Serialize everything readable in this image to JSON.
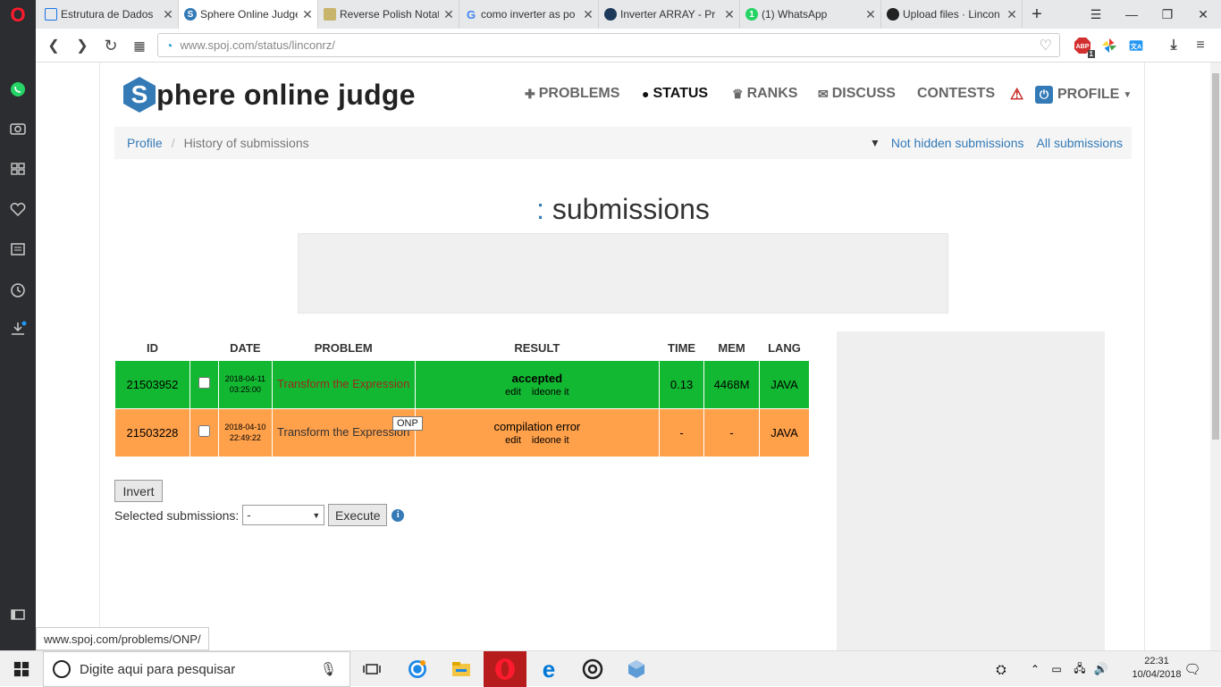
{
  "browser": {
    "tabs": [
      {
        "label": "Estrutura de Dados",
        "favicon": "doc-icon",
        "active": false
      },
      {
        "label": "Sphere Online Judge",
        "favicon": "spoj-icon",
        "active": true
      },
      {
        "label": "Reverse Polish Notation",
        "favicon": "book-icon",
        "active": false
      },
      {
        "label": "como inverter as po",
        "favicon": "google-icon",
        "active": false
      },
      {
        "label": "Inverter ARRAY - Pr",
        "favicon": "stackoverflow-icon",
        "active": false
      },
      {
        "label": "(1) WhatsApp",
        "favicon": "whatsapp-icon",
        "active": false
      },
      {
        "label": "Upload files · Lincon",
        "favicon": "github-icon",
        "active": false
      }
    ],
    "url_host": "www.spoj.com",
    "url_path": "/status/linconrz/",
    "status_url": "www.spoj.com/problems/ONP/",
    "ext_abp_badge": "1"
  },
  "site": {
    "logo_letter": "S",
    "logo_text": "phere online judge",
    "nav": {
      "problems": "PROBLEMS",
      "status": "STATUS",
      "ranks": "RANKS",
      "discuss": "DISCUSS",
      "contests": "CONTESTS",
      "profile": "PROFILE"
    },
    "breadcrumb": {
      "profile": "Profile",
      "current": "History of submissions",
      "not_hidden": "Not hidden submissions",
      "all": "All submissions"
    },
    "heading_colon": ":",
    "heading_text": "submissions",
    "table": {
      "headers": {
        "id": "ID",
        "date": "DATE",
        "problem": "PROBLEM",
        "result": "RESULT",
        "time": "TIME",
        "mem": "MEM",
        "lang": "LANG"
      },
      "rows": [
        {
          "id": "21503952",
          "date": "2018-04-11",
          "time_of_day": "03:25:00",
          "problem": "Transform the Expression",
          "result": "accepted",
          "edit": "edit",
          "ideone": "ideone it",
          "time": "0.13",
          "mem": "4468M",
          "lang": "JAVA",
          "color": "#13b832"
        },
        {
          "id": "21503228",
          "date": "2018-04-10",
          "time_of_day": "22:49:22",
          "problem": "Transform the Expression",
          "result": "compilation error",
          "edit": "edit",
          "ideone": "ideone it",
          "time": "-",
          "mem": "-",
          "lang": "JAVA",
          "color": "#ffa04a"
        }
      ]
    },
    "tooltip": "ONP",
    "invert_label": "Invert",
    "selected_label": "Selected submissions:",
    "select_value": "-",
    "execute_label": "Execute"
  },
  "taskbar": {
    "search_placeholder": "Digite aqui para pesquisar",
    "time": "22:31",
    "date": "10/04/2018"
  }
}
